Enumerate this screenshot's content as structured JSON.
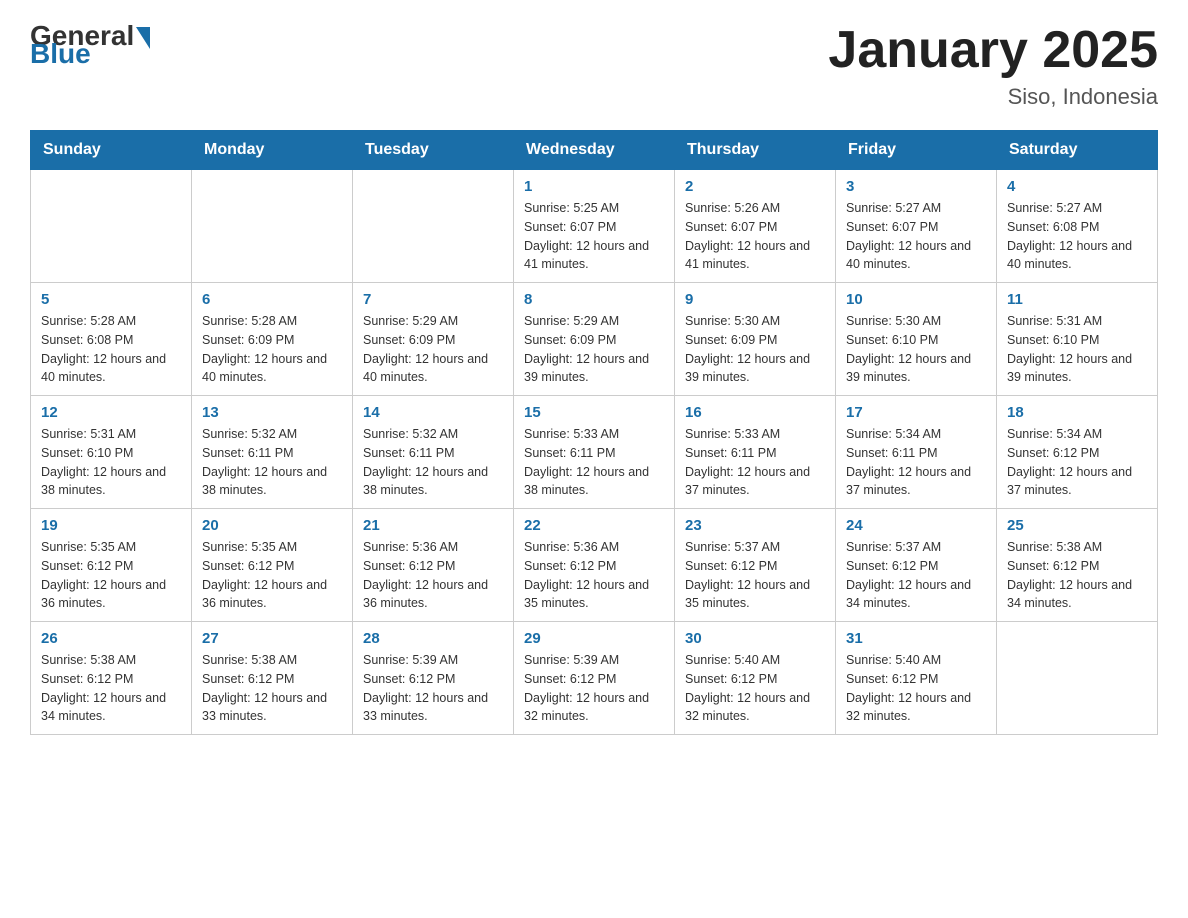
{
  "header": {
    "logo": {
      "general": "General",
      "blue": "Blue"
    },
    "title": "January 2025",
    "subtitle": "Siso, Indonesia"
  },
  "days_of_week": [
    "Sunday",
    "Monday",
    "Tuesday",
    "Wednesday",
    "Thursday",
    "Friday",
    "Saturday"
  ],
  "weeks": [
    [
      {
        "day": "",
        "sunrise": "",
        "sunset": "",
        "daylight": ""
      },
      {
        "day": "",
        "sunrise": "",
        "sunset": "",
        "daylight": ""
      },
      {
        "day": "",
        "sunrise": "",
        "sunset": "",
        "daylight": ""
      },
      {
        "day": "1",
        "sunrise": "Sunrise: 5:25 AM",
        "sunset": "Sunset: 6:07 PM",
        "daylight": "Daylight: 12 hours and 41 minutes."
      },
      {
        "day": "2",
        "sunrise": "Sunrise: 5:26 AM",
        "sunset": "Sunset: 6:07 PM",
        "daylight": "Daylight: 12 hours and 41 minutes."
      },
      {
        "day": "3",
        "sunrise": "Sunrise: 5:27 AM",
        "sunset": "Sunset: 6:07 PM",
        "daylight": "Daylight: 12 hours and 40 minutes."
      },
      {
        "day": "4",
        "sunrise": "Sunrise: 5:27 AM",
        "sunset": "Sunset: 6:08 PM",
        "daylight": "Daylight: 12 hours and 40 minutes."
      }
    ],
    [
      {
        "day": "5",
        "sunrise": "Sunrise: 5:28 AM",
        "sunset": "Sunset: 6:08 PM",
        "daylight": "Daylight: 12 hours and 40 minutes."
      },
      {
        "day": "6",
        "sunrise": "Sunrise: 5:28 AM",
        "sunset": "Sunset: 6:09 PM",
        "daylight": "Daylight: 12 hours and 40 minutes."
      },
      {
        "day": "7",
        "sunrise": "Sunrise: 5:29 AM",
        "sunset": "Sunset: 6:09 PM",
        "daylight": "Daylight: 12 hours and 40 minutes."
      },
      {
        "day": "8",
        "sunrise": "Sunrise: 5:29 AM",
        "sunset": "Sunset: 6:09 PM",
        "daylight": "Daylight: 12 hours and 39 minutes."
      },
      {
        "day": "9",
        "sunrise": "Sunrise: 5:30 AM",
        "sunset": "Sunset: 6:09 PM",
        "daylight": "Daylight: 12 hours and 39 minutes."
      },
      {
        "day": "10",
        "sunrise": "Sunrise: 5:30 AM",
        "sunset": "Sunset: 6:10 PM",
        "daylight": "Daylight: 12 hours and 39 minutes."
      },
      {
        "day": "11",
        "sunrise": "Sunrise: 5:31 AM",
        "sunset": "Sunset: 6:10 PM",
        "daylight": "Daylight: 12 hours and 39 minutes."
      }
    ],
    [
      {
        "day": "12",
        "sunrise": "Sunrise: 5:31 AM",
        "sunset": "Sunset: 6:10 PM",
        "daylight": "Daylight: 12 hours and 38 minutes."
      },
      {
        "day": "13",
        "sunrise": "Sunrise: 5:32 AM",
        "sunset": "Sunset: 6:11 PM",
        "daylight": "Daylight: 12 hours and 38 minutes."
      },
      {
        "day": "14",
        "sunrise": "Sunrise: 5:32 AM",
        "sunset": "Sunset: 6:11 PM",
        "daylight": "Daylight: 12 hours and 38 minutes."
      },
      {
        "day": "15",
        "sunrise": "Sunrise: 5:33 AM",
        "sunset": "Sunset: 6:11 PM",
        "daylight": "Daylight: 12 hours and 38 minutes."
      },
      {
        "day": "16",
        "sunrise": "Sunrise: 5:33 AM",
        "sunset": "Sunset: 6:11 PM",
        "daylight": "Daylight: 12 hours and 37 minutes."
      },
      {
        "day": "17",
        "sunrise": "Sunrise: 5:34 AM",
        "sunset": "Sunset: 6:11 PM",
        "daylight": "Daylight: 12 hours and 37 minutes."
      },
      {
        "day": "18",
        "sunrise": "Sunrise: 5:34 AM",
        "sunset": "Sunset: 6:12 PM",
        "daylight": "Daylight: 12 hours and 37 minutes."
      }
    ],
    [
      {
        "day": "19",
        "sunrise": "Sunrise: 5:35 AM",
        "sunset": "Sunset: 6:12 PM",
        "daylight": "Daylight: 12 hours and 36 minutes."
      },
      {
        "day": "20",
        "sunrise": "Sunrise: 5:35 AM",
        "sunset": "Sunset: 6:12 PM",
        "daylight": "Daylight: 12 hours and 36 minutes."
      },
      {
        "day": "21",
        "sunrise": "Sunrise: 5:36 AM",
        "sunset": "Sunset: 6:12 PM",
        "daylight": "Daylight: 12 hours and 36 minutes."
      },
      {
        "day": "22",
        "sunrise": "Sunrise: 5:36 AM",
        "sunset": "Sunset: 6:12 PM",
        "daylight": "Daylight: 12 hours and 35 minutes."
      },
      {
        "day": "23",
        "sunrise": "Sunrise: 5:37 AM",
        "sunset": "Sunset: 6:12 PM",
        "daylight": "Daylight: 12 hours and 35 minutes."
      },
      {
        "day": "24",
        "sunrise": "Sunrise: 5:37 AM",
        "sunset": "Sunset: 6:12 PM",
        "daylight": "Daylight: 12 hours and 34 minutes."
      },
      {
        "day": "25",
        "sunrise": "Sunrise: 5:38 AM",
        "sunset": "Sunset: 6:12 PM",
        "daylight": "Daylight: 12 hours and 34 minutes."
      }
    ],
    [
      {
        "day": "26",
        "sunrise": "Sunrise: 5:38 AM",
        "sunset": "Sunset: 6:12 PM",
        "daylight": "Daylight: 12 hours and 34 minutes."
      },
      {
        "day": "27",
        "sunrise": "Sunrise: 5:38 AM",
        "sunset": "Sunset: 6:12 PM",
        "daylight": "Daylight: 12 hours and 33 minutes."
      },
      {
        "day": "28",
        "sunrise": "Sunrise: 5:39 AM",
        "sunset": "Sunset: 6:12 PM",
        "daylight": "Daylight: 12 hours and 33 minutes."
      },
      {
        "day": "29",
        "sunrise": "Sunrise: 5:39 AM",
        "sunset": "Sunset: 6:12 PM",
        "daylight": "Daylight: 12 hours and 32 minutes."
      },
      {
        "day": "30",
        "sunrise": "Sunrise: 5:40 AM",
        "sunset": "Sunset: 6:12 PM",
        "daylight": "Daylight: 12 hours and 32 minutes."
      },
      {
        "day": "31",
        "sunrise": "Sunrise: 5:40 AM",
        "sunset": "Sunset: 6:12 PM",
        "daylight": "Daylight: 12 hours and 32 minutes."
      },
      {
        "day": "",
        "sunrise": "",
        "sunset": "",
        "daylight": ""
      }
    ]
  ]
}
